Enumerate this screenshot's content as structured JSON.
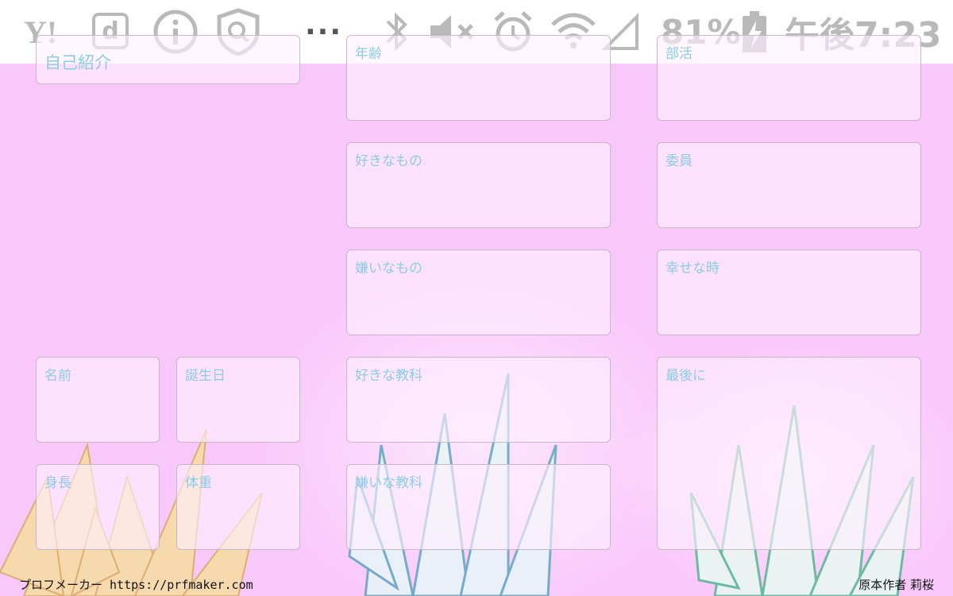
{
  "status_bar": {
    "yahoo_text": "Y!",
    "d_text": "d",
    "more_text": "···",
    "battery_percent": "81%",
    "time": "午後7:23",
    "icon_color": "#b9b9b9"
  },
  "card": {
    "title": "自己紹介",
    "fields": {
      "name": "名前",
      "birthday": "誕生日",
      "height": "身長",
      "weight": "体重",
      "age": "年齢",
      "likes": "好きなもの",
      "dislikes": "嫌いなもの",
      "fav_subject": "好きな教科",
      "hated_subject": "嫌いな教科",
      "club": "部活",
      "committee": "委員",
      "happy_time": "幸せな時",
      "finally": "最後に"
    }
  },
  "footer": {
    "left": "プロフメーカー https://prfmaker.com",
    "right": "原本作者 莉桜"
  },
  "colors": {
    "background": "#f9c8fb",
    "label": "#89cde6",
    "box_fill": "#ffeefe"
  }
}
